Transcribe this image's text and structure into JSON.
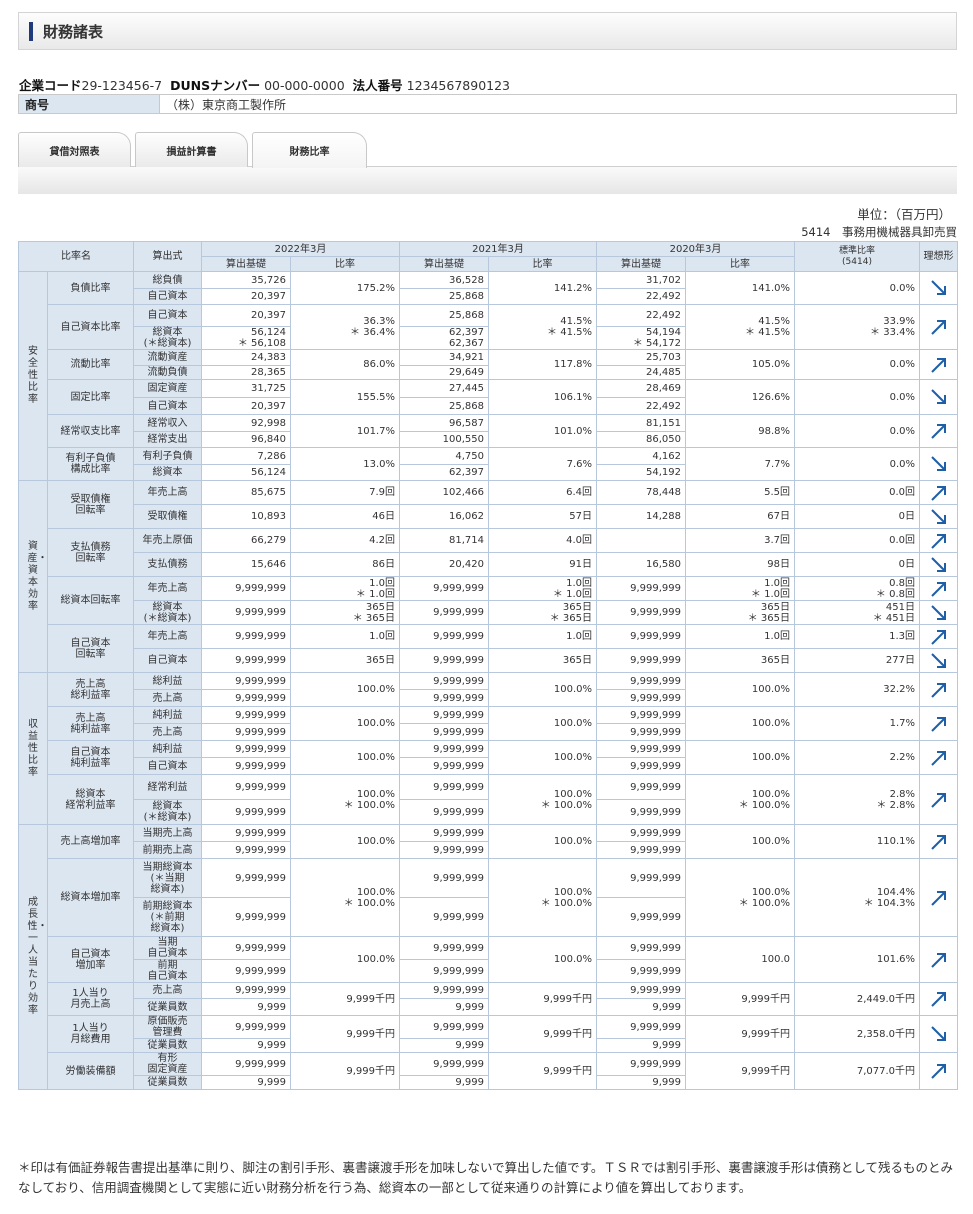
{
  "page_title": "財務諸表",
  "company": {
    "code_label": "企業コード",
    "code": "29-123456-7",
    "duns_label": "DUNSナンバー",
    "duns": "00-000-0000",
    "corp_label": "法人番号",
    "corp": "1234567890123",
    "shogo_label": "商号",
    "shogo": "（株）東京商工製作所"
  },
  "tabs": [
    "貸借対照表",
    "損益計算書",
    "財務比率"
  ],
  "active_tab": 2,
  "unit": "単位：（百万円）",
  "industry": "5414　事務用機械器具卸売買",
  "header": {
    "ratio_name": "比率名",
    "formula": "算出式",
    "years": [
      "2022年3月",
      "2021年3月",
      "2020年3月"
    ],
    "base": "算出基礎",
    "ratio": "比率",
    "standard": "標準比率\n(5414)",
    "ideal": "理想形"
  },
  "sections": [
    {
      "name": "安全性比率",
      "items": [
        {
          "name": "負債比率",
          "lines": [
            {
              "f": "総負債",
              "v": [
                "35,726",
                "36,528",
                "31,702"
              ]
            },
            {
              "f": "自己資本",
              "v": [
                "20,397",
                "25,868",
                "22,492"
              ]
            }
          ],
          "r": [
            "175.2%",
            "141.2%",
            "141.0%"
          ],
          "std": "0.0%",
          "trend": "down"
        },
        {
          "name": "自己資本比率",
          "lines": [
            {
              "f": "自己資本",
              "v": [
                "20,397",
                "25,868",
                "22,492"
              ]
            },
            {
              "f": "総資本\n(＊総資本)",
              "v": [
                "56,124\n＊ 56,108",
                "62,397\n62,367",
                "54,194\n＊ 54,172"
              ]
            }
          ],
          "r": [
            "36.3%\n＊ 36.4%",
            "41.5%\n＊ 41.5%",
            "41.5%\n＊ 41.5%"
          ],
          "std": "33.9%\n＊ 33.4%",
          "trend": "up"
        },
        {
          "name": "流動比率",
          "lines": [
            {
              "f": "流動資産",
              "v": [
                "24,383",
                "34,921",
                "25,703"
              ]
            },
            {
              "f": "流動負債",
              "v": [
                "28,365",
                "29,649",
                "24,485"
              ]
            }
          ],
          "r": [
            "86.0%",
            "117.8%",
            "105.0%"
          ],
          "std": "0.0%",
          "trend": "up"
        },
        {
          "name": "固定比率",
          "lines": [
            {
              "f": "固定資産",
              "v": [
                "31,725",
                "27,445",
                "28,469"
              ]
            },
            {
              "f": "自己資本",
              "v": [
                "20,397",
                "25,868",
                "22,492"
              ]
            }
          ],
          "r": [
            "155.5%",
            "106.1%",
            "126.6%"
          ],
          "std": "0.0%",
          "trend": "down"
        },
        {
          "name": "経常収支比率",
          "lines": [
            {
              "f": "経常収入",
              "v": [
                "92,998",
                "96,587",
                "81,151"
              ]
            },
            {
              "f": "経常支出",
              "v": [
                "96,840",
                "100,550",
                "86,050"
              ]
            }
          ],
          "r": [
            "101.7%",
            "101.0%",
            "98.8%"
          ],
          "std": "0.0%",
          "trend": "up"
        },
        {
          "name": "有利子負債\n構成比率",
          "lines": [
            {
              "f": "有利子負債",
              "v": [
                "7,286",
                "4,750",
                "4,162"
              ]
            },
            {
              "f": "総資本",
              "v": [
                "56,124",
                "62,397",
                "54,192"
              ]
            }
          ],
          "r": [
            "13.0%",
            "7.6%",
            "7.7%"
          ],
          "std": "0.0%",
          "trend": "down"
        }
      ]
    },
    {
      "name": "資産・資本効率",
      "items": [
        {
          "name": "受取債権\n回転率",
          "rows": [
            {
              "f": "年売上高",
              "v": [
                "85,675",
                "102,466",
                "78,448"
              ],
              "r": [
                "7.9回",
                "6.4回",
                "5.5回"
              ],
              "std": "0.0回",
              "trend": "up"
            },
            {
              "f": "受取債権",
              "v": [
                "10,893",
                "16,062",
                "14,288"
              ],
              "r": [
                "46日",
                "57日",
                "67日"
              ],
              "std": "0日",
              "trend": "down"
            }
          ]
        },
        {
          "name": "支払債務\n回転率",
          "rows": [
            {
              "f": "年売上原価",
              "v": [
                "66,279",
                "81,714",
                ""
              ],
              "r": [
                "4.2回",
                "4.0回",
                "3.7回"
              ],
              "std": "0.0回",
              "trend": "up"
            },
            {
              "f": "支払債務",
              "v": [
                "15,646",
                "20,420",
                "16,580"
              ],
              "r": [
                "86日",
                "91日",
                "98日"
              ],
              "std": "0日",
              "trend": "down"
            }
          ]
        },
        {
          "name": "総資本回転率",
          "rows": [
            {
              "f": "年売上高",
              "v": [
                "9,999,999",
                "9,999,999",
                "9,999,999"
              ],
              "r": [
                "1.0回\n＊ 1.0回",
                "1.0回\n＊ 1.0回",
                "1.0回\n＊ 1.0回"
              ],
              "std": "0.8回\n＊ 0.8回",
              "trend": "up"
            },
            {
              "f": "総資本\n(＊総資本)",
              "v": [
                "9,999,999",
                "9,999,999",
                "9,999,999"
              ],
              "r": [
                "365日\n＊ 365日",
                "365日\n＊ 365日",
                "365日\n＊ 365日"
              ],
              "std": "451日\n＊ 451日",
              "trend": "down"
            }
          ]
        },
        {
          "name": "自己資本\n回転率",
          "rows": [
            {
              "f": "年売上高",
              "v": [
                "9,999,999",
                "9,999,999",
                "9,999,999"
              ],
              "r": [
                "1.0回",
                "1.0回",
                "1.0回"
              ],
              "std": "1.3回",
              "trend": "up"
            },
            {
              "f": "自己資本",
              "v": [
                "9,999,999",
                "9,999,999",
                "9,999,999"
              ],
              "r": [
                "365日",
                "365日",
                "365日"
              ],
              "std": "277日",
              "trend": "down"
            }
          ]
        }
      ]
    },
    {
      "name": "収益性比率",
      "items": [
        {
          "name": "売上高\n総利益率",
          "lines": [
            {
              "f": "総利益",
              "v": [
                "9,999,999",
                "9,999,999",
                "9,999,999"
              ]
            },
            {
              "f": "売上高",
              "v": [
                "9,999,999",
                "9,999,999",
                "9,999,999"
              ]
            }
          ],
          "r": [
            "100.0%",
            "100.0%",
            "100.0%"
          ],
          "std": "32.2%",
          "trend": "up"
        },
        {
          "name": "売上高\n純利益率",
          "lines": [
            {
              "f": "純利益",
              "v": [
                "9,999,999",
                "9,999,999",
                "9,999,999"
              ]
            },
            {
              "f": "売上高",
              "v": [
                "9,999,999",
                "9,999,999",
                "9,999,999"
              ]
            }
          ],
          "r": [
            "100.0%",
            "100.0%",
            "100.0%"
          ],
          "std": "1.7%",
          "trend": "up"
        },
        {
          "name": "自己資本\n純利益率",
          "lines": [
            {
              "f": "純利益",
              "v": [
                "9,999,999",
                "9,999,999",
                "9,999,999"
              ]
            },
            {
              "f": "自己資本",
              "v": [
                "9,999,999",
                "9,999,999",
                "9,999,999"
              ]
            }
          ],
          "r": [
            "100.0%",
            "100.0%",
            "100.0%"
          ],
          "std": "2.2%",
          "trend": "up"
        },
        {
          "name": "総資本\n経常利益率",
          "lines": [
            {
              "f": "経常利益",
              "v": [
                "9,999,999",
                "9,999,999",
                "9,999,999"
              ]
            },
            {
              "f": "総資本\n(＊総資本)",
              "v": [
                "9,999,999",
                "9,999,999",
                "9,999,999"
              ]
            }
          ],
          "r": [
            "100.0%\n＊ 100.0%",
            "100.0%\n＊ 100.0%",
            "100.0%\n＊ 100.0%"
          ],
          "std": "2.8%\n＊ 2.8%",
          "trend": "up"
        }
      ]
    },
    {
      "name": "成長性・一人当たり効率",
      "items": [
        {
          "name": "売上高増加率",
          "lines": [
            {
              "f": "当期売上高",
              "v": [
                "9,999,999",
                "9,999,999",
                "9,999,999"
              ]
            },
            {
              "f": "前期売上高",
              "v": [
                "9,999,999",
                "9,999,999",
                "9,999,999"
              ]
            }
          ],
          "r": [
            "100.0%",
            "100.0%",
            "100.0%"
          ],
          "std": "110.1%",
          "trend": "up"
        },
        {
          "name": "総資本増加率",
          "lines": [
            {
              "f": "当期総資本\n(＊当期\n総資本)",
              "v": [
                "9,999,999",
                "9,999,999",
                "9,999,999"
              ]
            },
            {
              "f": "前期総資本\n(＊前期\n総資本)",
              "v": [
                "9,999,999",
                "9,999,999",
                "9,999,999"
              ]
            }
          ],
          "r": [
            "100.0%\n＊ 100.0%",
            "100.0%\n＊ 100.0%",
            "100.0%\n＊ 100.0%"
          ],
          "std": "104.4%\n＊ 104.3%",
          "trend": "up"
        },
        {
          "name": "自己資本\n増加率",
          "lines": [
            {
              "f": "当期\n自己資本",
              "v": [
                "9,999,999",
                "9,999,999",
                "9,999,999"
              ]
            },
            {
              "f": "前期\n自己資本",
              "v": [
                "9,999,999",
                "9,999,999",
                "9,999,999"
              ]
            }
          ],
          "r": [
            "100.0%",
            "100.0%",
            "100.0"
          ],
          "std": "101.6%",
          "trend": "up"
        },
        {
          "name": "1人当り\n月売上高",
          "lines": [
            {
              "f": "売上高",
              "v": [
                "9,999,999",
                "9,999,999",
                "9,999,999"
              ]
            },
            {
              "f": "従業員数",
              "v": [
                "9,999",
                "9,999",
                "9,999"
              ]
            }
          ],
          "r": [
            "9,999千円",
            "9,999千円",
            "9,999千円"
          ],
          "std": "2,449.0千円",
          "trend": "up"
        },
        {
          "name": "1人当り\n月総費用",
          "lines": [
            {
              "f": "原価販売\n管理費",
              "v": [
                "9,999,999",
                "9,999,999",
                "9,999,999"
              ]
            },
            {
              "f": "従業員数",
              "v": [
                "9,999",
                "9,999",
                "9,999"
              ]
            }
          ],
          "r": [
            "9,999千円",
            "9,999千円",
            "9,999千円"
          ],
          "std": "2,358.0千円",
          "trend": "down"
        },
        {
          "name": "労働装備額",
          "lines": [
            {
              "f": "有形\n固定資産",
              "v": [
                "9,999,999",
                "9,999,999",
                "9,999,999"
              ]
            },
            {
              "f": "従業員数",
              "v": [
                "9,999",
                "9,999",
                "9,999"
              ]
            }
          ],
          "r": [
            "9,999千円",
            "9,999千円",
            "9,999千円"
          ],
          "std": "7,077.0千円",
          "trend": "up"
        }
      ]
    }
  ],
  "note": "＊印は有価証券報告書提出基準に則り、脚注の割引手形、裏書譲渡手形を加味しないで算出した値です。ＴＳＲでは割引手形、裏書譲渡手形は債務として残るものとみなしており、信用調査機関として実態に近い財務分析を行う為、総資本の一部として従来通りの計算により値を算出しております。",
  "colors": {
    "header_bg": "#dce6f1",
    "border": "#b8c8dc",
    "arrow": "#1f5fa8",
    "title_bar": "#1f3a7a"
  },
  "icons": {
    "up": "arrow-up-right-icon",
    "down": "arrow-down-right-icon"
  }
}
